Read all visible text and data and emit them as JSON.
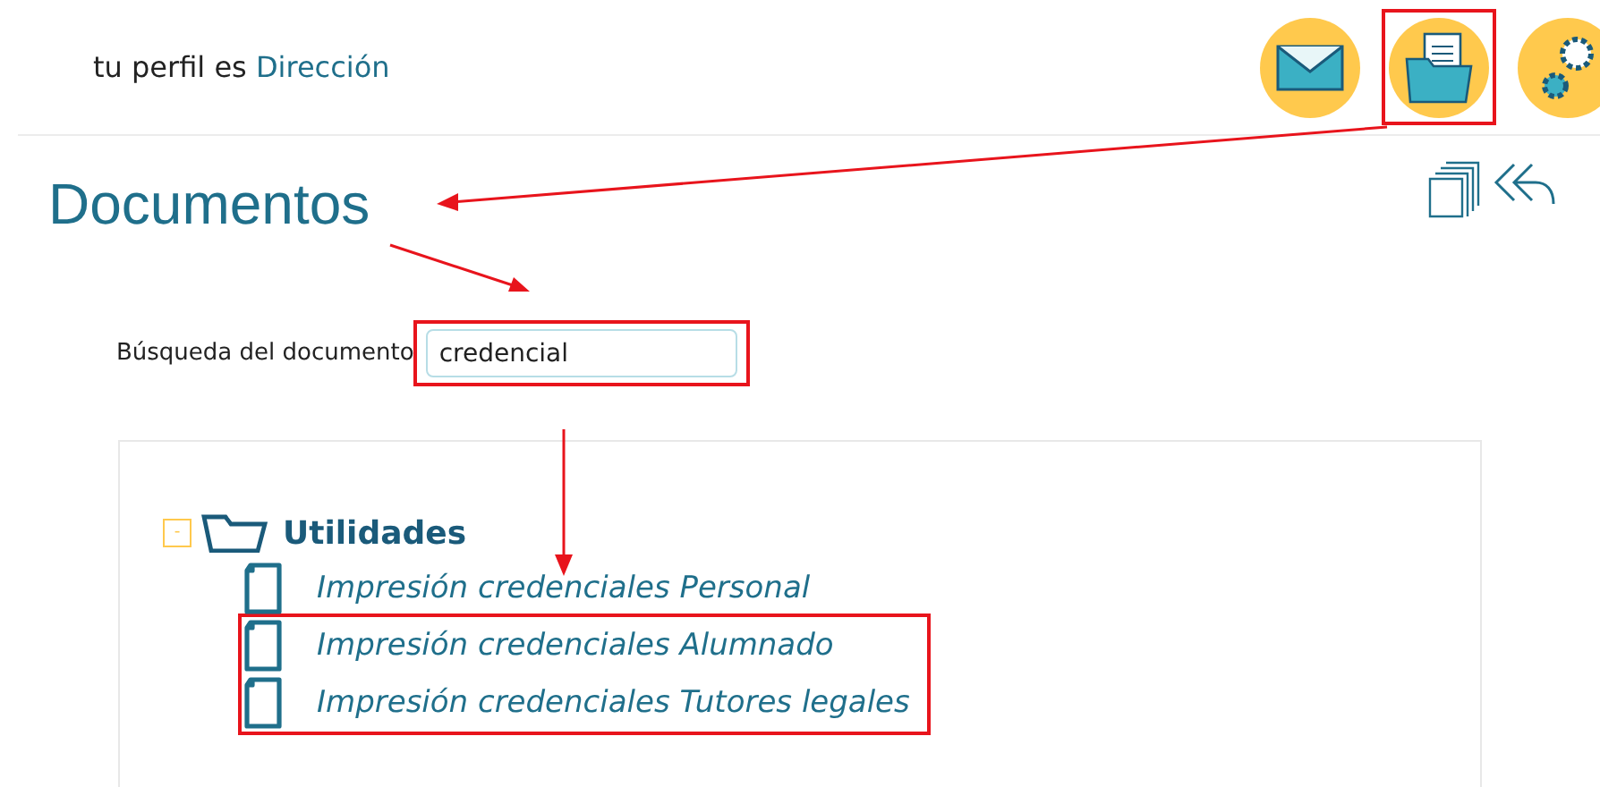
{
  "header": {
    "profile_prefix": "tu perfil es",
    "profile_role": "Dirección",
    "nav_icons": [
      {
        "kind": "mail",
        "highlighted": false
      },
      {
        "kind": "documents",
        "highlighted": true
      },
      {
        "kind": "settings",
        "highlighted": false
      }
    ]
  },
  "page_title": "Documentos",
  "search": {
    "label": "Búsqueda del documento",
    "value": "credencial",
    "highlighted": true
  },
  "tree": [
    {
      "label": "Utilidades",
      "expanded": true,
      "toggle": "-",
      "children": [
        {
          "label": "Impresión credenciales Personal",
          "highlighted": false
        },
        {
          "label": "Impresión credenciales Alumnado",
          "highlighted": true
        },
        {
          "label": "Impresión credenciales Tutores legales",
          "highlighted": true
        }
      ]
    }
  ]
}
